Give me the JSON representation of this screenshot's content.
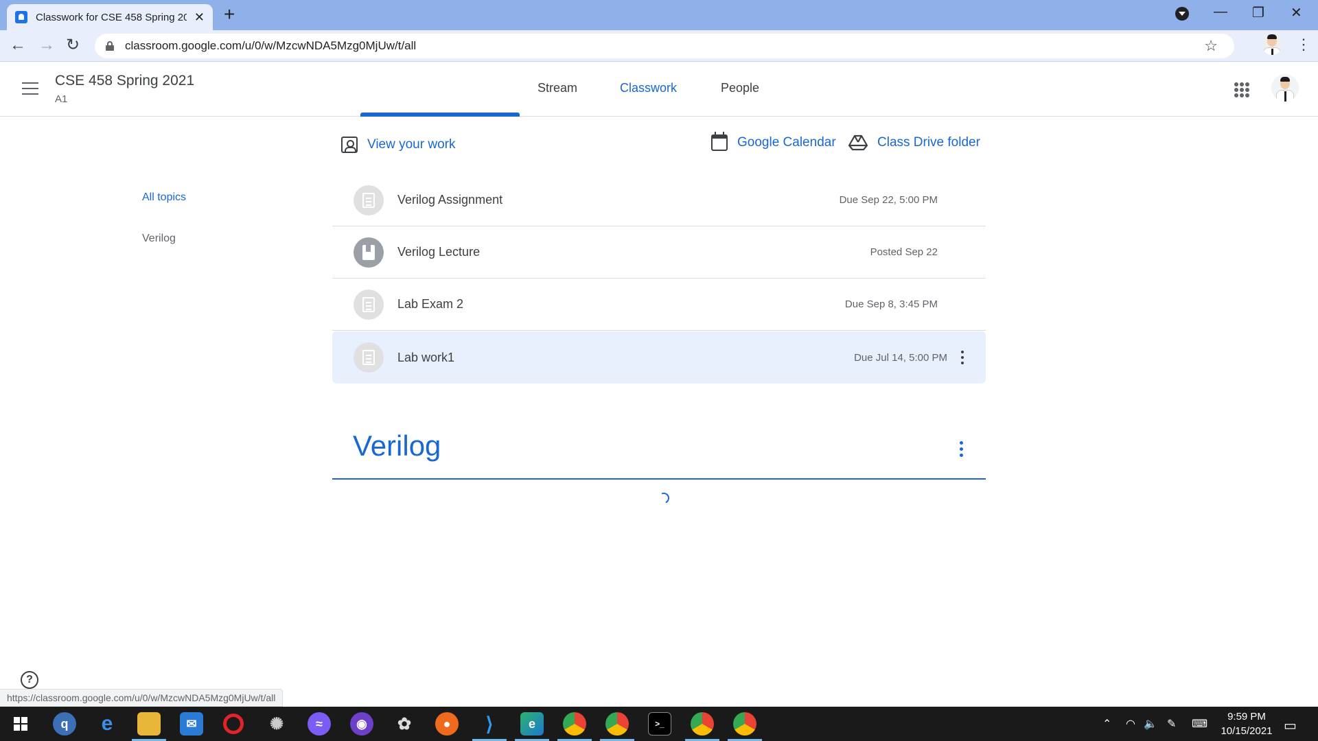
{
  "browser": {
    "tab_title": "Classwork for CSE 458 Spring 2021",
    "url": "classroom.google.com/u/0/w/MzcwNDA5Mzg0MjUw/t/all",
    "status_url": "https://classroom.google.com/u/0/w/MzcwNDA5Mzg0MjUw/t/all"
  },
  "header": {
    "class_name": "CSE 458 Spring 2021",
    "section": "A1",
    "tabs": [
      {
        "label": "Stream"
      },
      {
        "label": "Classwork"
      },
      {
        "label": "People"
      }
    ]
  },
  "actions": {
    "view_work": "View your work",
    "calendar": "Google Calendar",
    "drive": "Class Drive folder"
  },
  "sidebar": {
    "topics": [
      {
        "label": "All topics"
      },
      {
        "label": "Verilog"
      }
    ]
  },
  "items": [
    {
      "title": "Verilog Assignment",
      "date": "Due Sep 22, 5:00 PM",
      "icon": "assignment-icon"
    },
    {
      "title": "Verilog Lecture",
      "date": "Posted Sep 22",
      "icon": "material-icon"
    },
    {
      "title": "Lab Exam 2",
      "date": "Due Sep 8, 3:45 PM",
      "icon": "assignment-icon"
    },
    {
      "title": "Lab work1",
      "date": "Due Jul 14, 5:00 PM",
      "icon": "assignment-icon"
    }
  ],
  "topic_section": {
    "title": "Verilog"
  },
  "taskbar": {
    "time": "9:59 PM",
    "date": "10/15/2021"
  },
  "colors": {
    "accent": "#1967d2",
    "tabstrip": "#8fb0e8",
    "hover_row": "#e8f0fe"
  }
}
